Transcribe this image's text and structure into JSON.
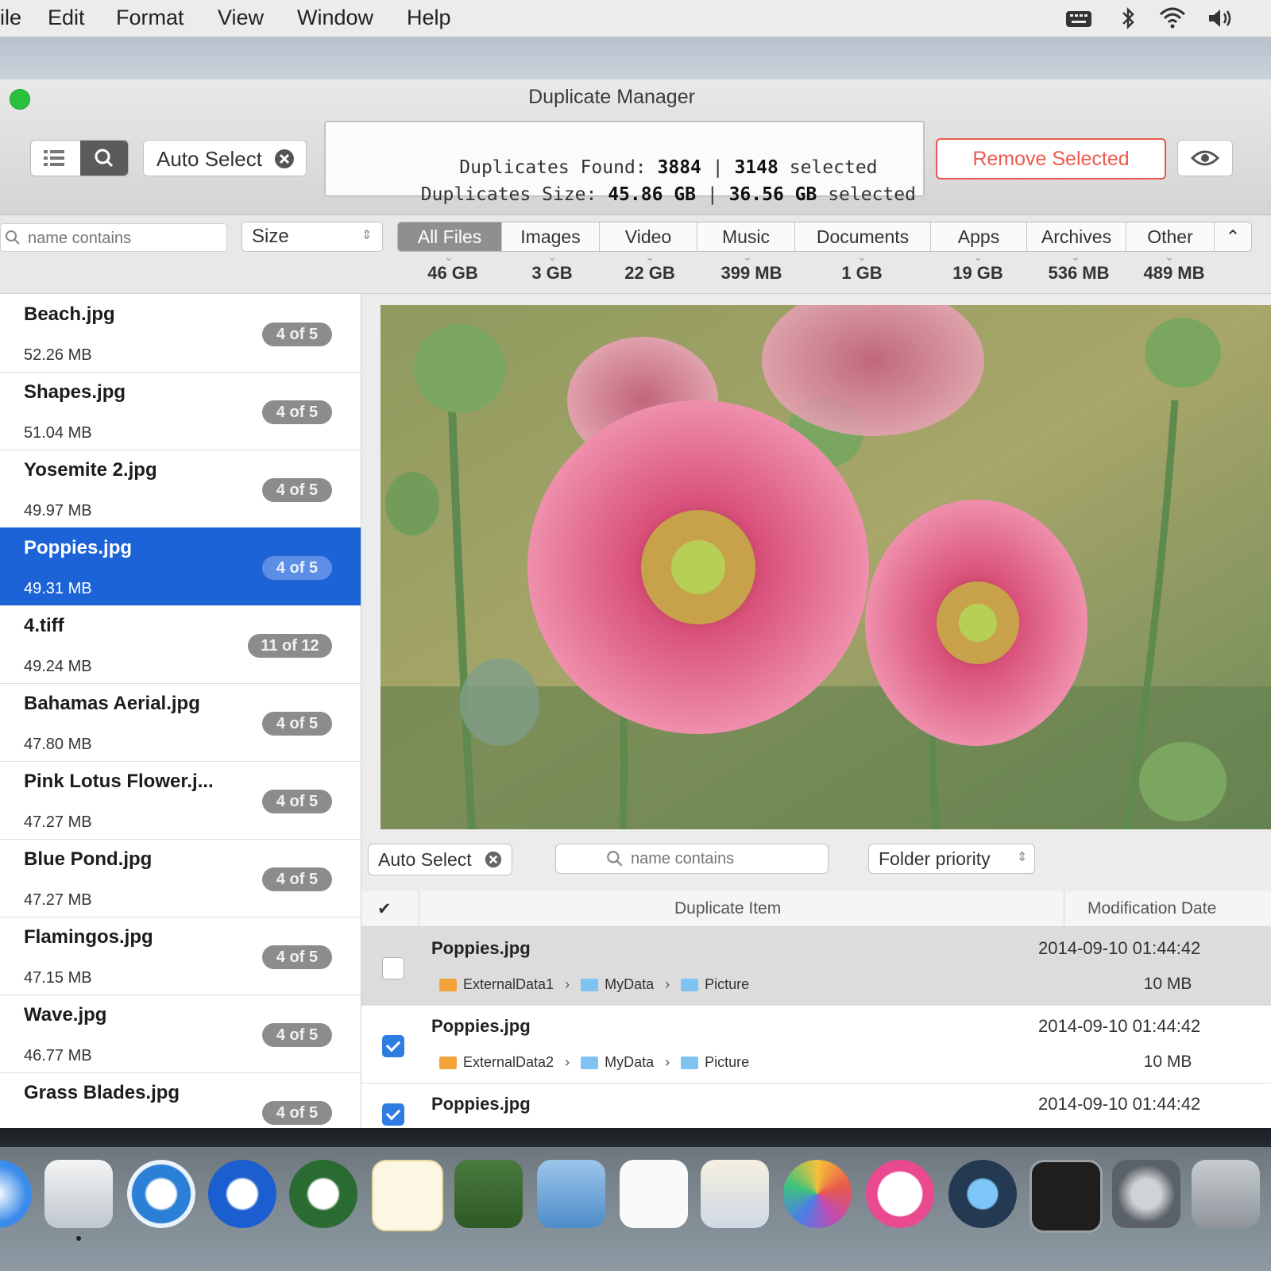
{
  "menubar": {
    "items": [
      "ile",
      "Edit",
      "Format",
      "View",
      "Window",
      "Help"
    ],
    "status_icons": [
      "keyboard-icon",
      "bluetooth-icon",
      "wifi-icon",
      "volume-icon"
    ]
  },
  "window": {
    "title": "Duplicate Manager",
    "view_toggle": [
      "list-view-icon",
      "search-view-icon"
    ],
    "auto_select_label": "Auto Select",
    "stats": {
      "found_label": "Duplicates Found:",
      "found_count": "3884",
      "found_selected": "3148",
      "size_label": "Duplicates Size:",
      "size_total": "45.86 GB",
      "size_selected": "36.56 GB",
      "selected_word": "selected",
      "separator": "|"
    },
    "remove_label": "Remove Selected",
    "accent_remove": "#ef5a4f"
  },
  "filters": {
    "search_placeholder": "name contains",
    "sort_value": "Size",
    "tabs": [
      {
        "label": "All Files",
        "size": "46 GB",
        "active": true
      },
      {
        "label": "Images",
        "size": "3 GB"
      },
      {
        "label": "Video",
        "size": "22 GB"
      },
      {
        "label": "Music",
        "size": "399 MB"
      },
      {
        "label": "Documents",
        "size": "1 GB"
      },
      {
        "label": "Apps",
        "size": "19 GB"
      },
      {
        "label": "Archives",
        "size": "536 MB"
      },
      {
        "label": "Other",
        "size": "489 MB"
      }
    ]
  },
  "files": [
    {
      "name": "Beach.jpg",
      "size": "52.26 MB",
      "badge": "4 of 5"
    },
    {
      "name": "Shapes.jpg",
      "size": "51.04 MB",
      "badge": "4 of 5"
    },
    {
      "name": "Yosemite 2.jpg",
      "size": "49.97 MB",
      "badge": "4 of 5"
    },
    {
      "name": "Poppies.jpg",
      "size": "49.31 MB",
      "badge": "4 of 5",
      "selected": true
    },
    {
      "name": "4.tiff",
      "size": "49.24 MB",
      "badge": "11 of 12"
    },
    {
      "name": "Bahamas Aerial.jpg",
      "size": "47.80 MB",
      "badge": "4 of 5"
    },
    {
      "name": "Pink Lotus Flower.j...",
      "size": "47.27 MB",
      "badge": "4 of 5"
    },
    {
      "name": "Blue Pond.jpg",
      "size": "47.27 MB",
      "badge": "4 of 5"
    },
    {
      "name": "Flamingos.jpg",
      "size": "47.15 MB",
      "badge": "4 of 5"
    },
    {
      "name": "Wave.jpg",
      "size": "46.77 MB",
      "badge": "4 of 5"
    },
    {
      "name": "Grass Blades.jpg",
      "size": "",
      "badge": "4 of 5"
    }
  ],
  "detail": {
    "auto_select_label": "Auto Select",
    "search_placeholder": "name contains",
    "priority_value": "Folder priority",
    "columns": {
      "check": "✔",
      "item": "Duplicate Item",
      "date": "Modification Date"
    },
    "rows": [
      {
        "name": "Poppies.jpg",
        "date": "2014-09-10 01:44:42",
        "size": "10 MB",
        "checked": false,
        "path": [
          "ExternalData1",
          "MyData",
          "Picture"
        ]
      },
      {
        "name": "Poppies.jpg",
        "date": "2014-09-10 01:44:42",
        "size": "10 MB",
        "checked": true,
        "path": [
          "ExternalData2",
          "MyData",
          "Picture"
        ]
      },
      {
        "name": "Poppies.jpg",
        "date": "2014-09-10 01:44:42",
        "size": "",
        "checked": true,
        "path": []
      }
    ]
  },
  "dock": {
    "icons": [
      "safari-icon",
      "preview-icon",
      "sync-icon",
      "sync-blue-icon",
      "sync-green-icon",
      "textedit-icon",
      "vpn-icon",
      "mail-stamp-icon",
      "notes-icon",
      "photo-viewer-icon",
      "photos-icon",
      "itunes-icon",
      "quicktime-icon",
      "terminal-icon",
      "system-preferences-icon",
      "trash-icon"
    ]
  }
}
